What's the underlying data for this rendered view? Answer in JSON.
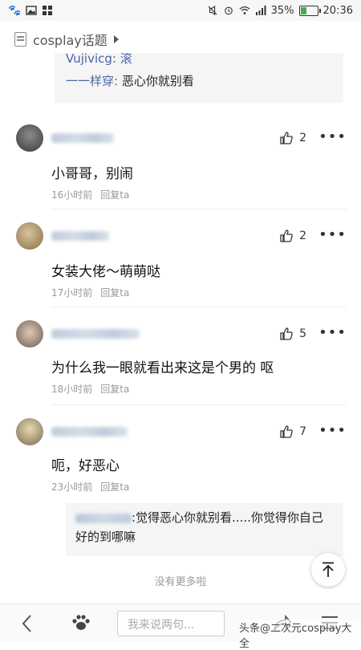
{
  "status_bar": {
    "battery": "35%",
    "time": "20:36"
  },
  "header": {
    "title": "cosplay话题"
  },
  "top_quote": {
    "line1_name": "Vujivicg:",
    "line1_text": "滚",
    "line2_name": "一一样穿:",
    "line2_text": "恶心你就别看"
  },
  "comments": [
    {
      "likes": "2",
      "text": "小哥哥，别闹",
      "time": "16小时前",
      "reply": "回复ta"
    },
    {
      "likes": "2",
      "text": "女装大佬～萌萌哒",
      "time": "17小时前",
      "reply": "回复ta"
    },
    {
      "likes": "5",
      "text": "为什么我一眼就看出来这是个男的 呕",
      "time": "18小时前",
      "reply": "回复ta"
    },
    {
      "likes": "7",
      "text": "呃，好恶心",
      "time": "23小时前",
      "reply": "回复ta"
    }
  ],
  "reply_quote": {
    "text": ":觉得恶心你就别看.....你觉得你自己好的到哪嘛"
  },
  "no_more": "没有更多啦",
  "bottom_bar": {
    "input_placeholder": "我来说两句..."
  },
  "watermark": "头条@二次元cosplay大全",
  "colors": {
    "link_blue": "#4a66a6",
    "meta_gray": "#999999",
    "battery_green": "#3bb34a"
  },
  "icons": [
    "paw-icon",
    "image-icon",
    "grid-icon",
    "mute-icon",
    "alarm-icon",
    "wifi-icon",
    "signal-icon",
    "battery-icon",
    "document-icon",
    "caret-right-icon",
    "thumbs-up-icon",
    "more-icon",
    "arrow-up-icon",
    "back-icon",
    "share-icon",
    "menu-icon"
  ]
}
